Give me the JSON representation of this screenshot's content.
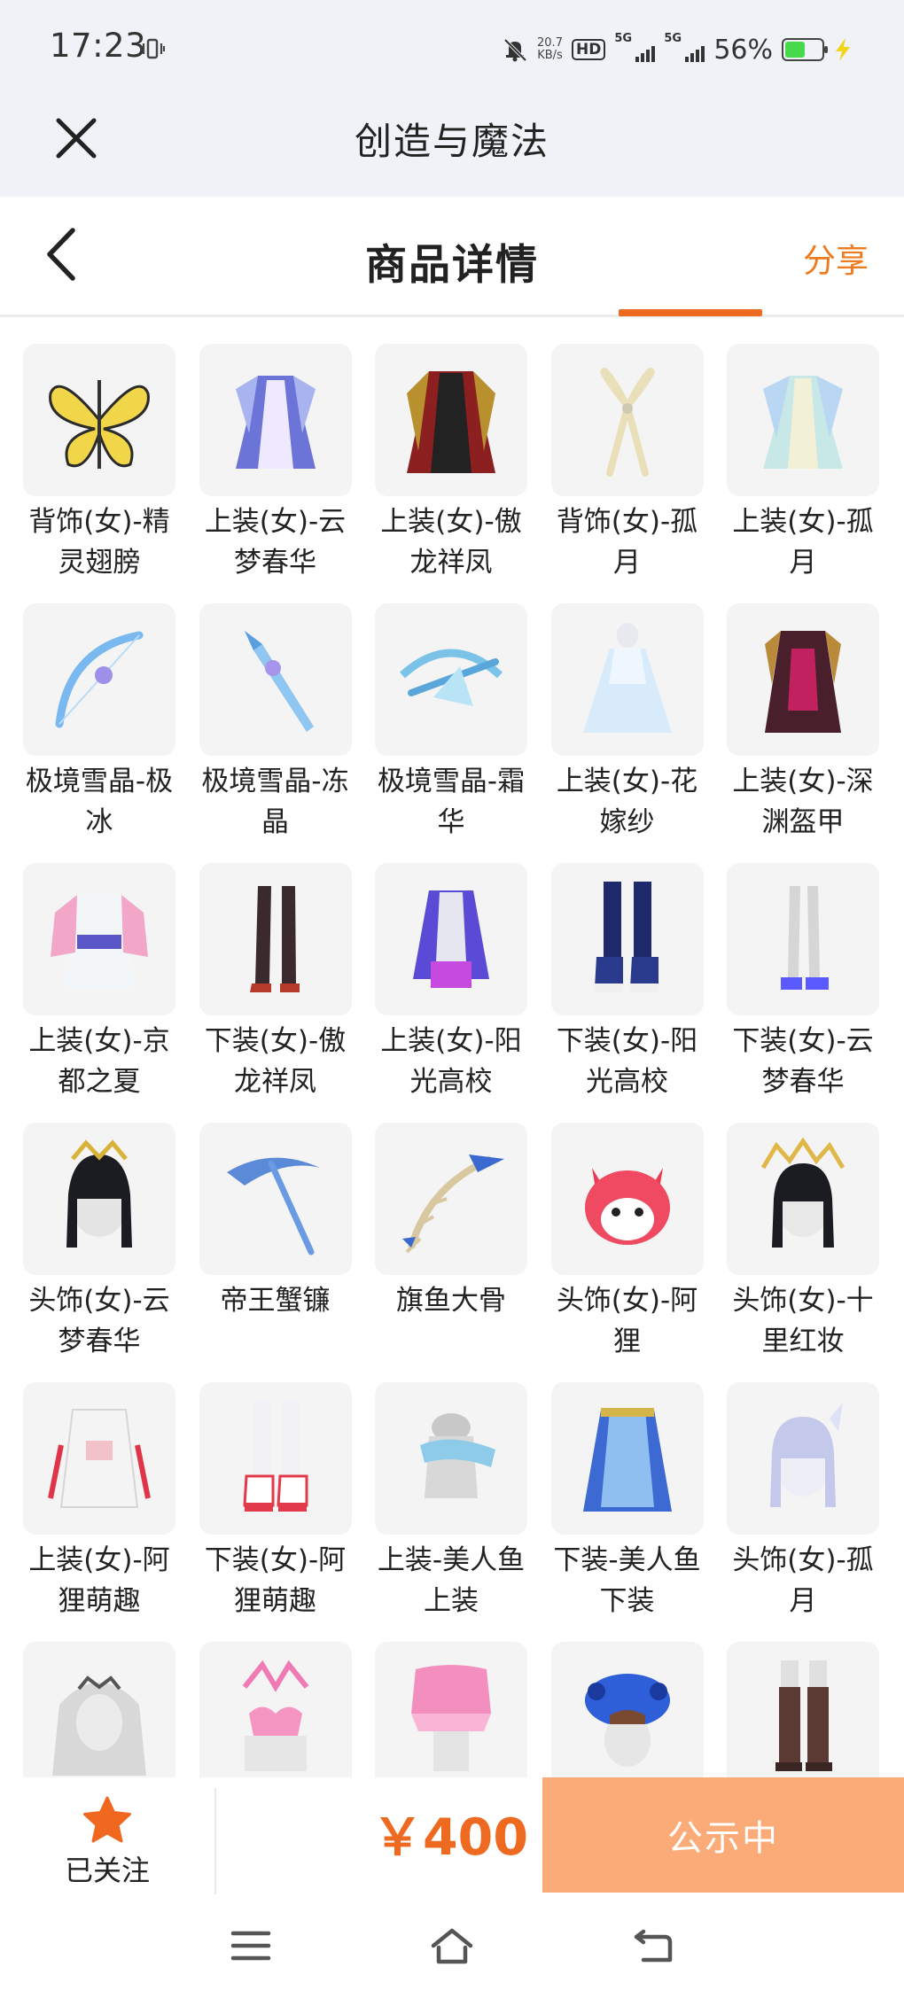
{
  "status_bar": {
    "time": "17:23",
    "net_speed_value": "20.7",
    "net_speed_unit": "KB/s",
    "hd_label": "HD",
    "sim1_label": "5G",
    "sim2_label": "5G",
    "battery_text": "56%",
    "battery_level": 0.56,
    "battery_color": "#47d84c"
  },
  "app_header": {
    "title": "创造与魔法",
    "close_icon": "close-icon"
  },
  "page_nav": {
    "title": "商品详情",
    "share_label": "分享",
    "back_icon": "chevron-left-icon",
    "accent_color": "#ef6a21"
  },
  "items": [
    {
      "name": "背饰(女)-精灵翅膀",
      "icon": "butterfly-wings"
    },
    {
      "name": "上装(女)-云梦春华",
      "icon": "blue-gown"
    },
    {
      "name": "上装(女)-傲龙祥凤",
      "icon": "red-black-robe"
    },
    {
      "name": "背饰(女)-孤月",
      "icon": "ribbon"
    },
    {
      "name": "上装(女)-孤月",
      "icon": "pastel-dress"
    },
    {
      "name": "极境雪晶-极冰",
      "icon": "ice-bow"
    },
    {
      "name": "极境雪晶-冻晶",
      "icon": "ice-spear"
    },
    {
      "name": "极境雪晶-霜华",
      "icon": "ice-crossbow"
    },
    {
      "name": "上装(女)-花嫁纱",
      "icon": "wedding-dress"
    },
    {
      "name": "上装(女)-深渊盔甲",
      "icon": "dark-armor"
    },
    {
      "name": "上装(女)-京都之夏",
      "icon": "kimono"
    },
    {
      "name": "下装(女)-傲龙祥凤",
      "icon": "dark-stockings"
    },
    {
      "name": "上装(女)-阳光高校",
      "icon": "school-jacket"
    },
    {
      "name": "下装(女)-阳光高校",
      "icon": "navy-sneakers"
    },
    {
      "name": "下装(女)-云梦春华",
      "icon": "white-heels"
    },
    {
      "name": "头饰(女)-云梦春华",
      "icon": "black-hair-crown"
    },
    {
      "name": "帝王蟹镰",
      "icon": "scythe"
    },
    {
      "name": "旗鱼大骨",
      "icon": "fishbone-scythe"
    },
    {
      "name": "头饰(女)-阿狸",
      "icon": "ali-fox-head"
    },
    {
      "name": "头饰(女)-十里红妆",
      "icon": "gold-headdress"
    },
    {
      "name": "上装(女)-阿狸萌趣",
      "icon": "white-hoodie"
    },
    {
      "name": "下装(女)-阿狸萌趣",
      "icon": "pink-boots"
    },
    {
      "name": "上装-美人鱼上装",
      "icon": "mermaid-top"
    },
    {
      "name": "下装-美人鱼下装",
      "icon": "mermaid-skirt"
    },
    {
      "name": "头饰(女)-孤月",
      "icon": "silver-hair"
    },
    {
      "name": "",
      "icon": "bridal-veil"
    },
    {
      "name": "",
      "icon": "pink-bikini-top"
    },
    {
      "name": "",
      "icon": "pink-skirt"
    },
    {
      "name": "",
      "icon": "octopus-hat"
    },
    {
      "name": "",
      "icon": "brown-boots"
    }
  ],
  "action_bar": {
    "follow_label": "已关注",
    "follow_icon": "star-icon",
    "price": "￥400",
    "status_label": "公示中",
    "status_color": "#fbab78",
    "price_color": "#ef6a21"
  },
  "system_nav": {
    "menu_icon": "menu-icon",
    "home_icon": "home-icon",
    "back_icon": "back-icon"
  }
}
